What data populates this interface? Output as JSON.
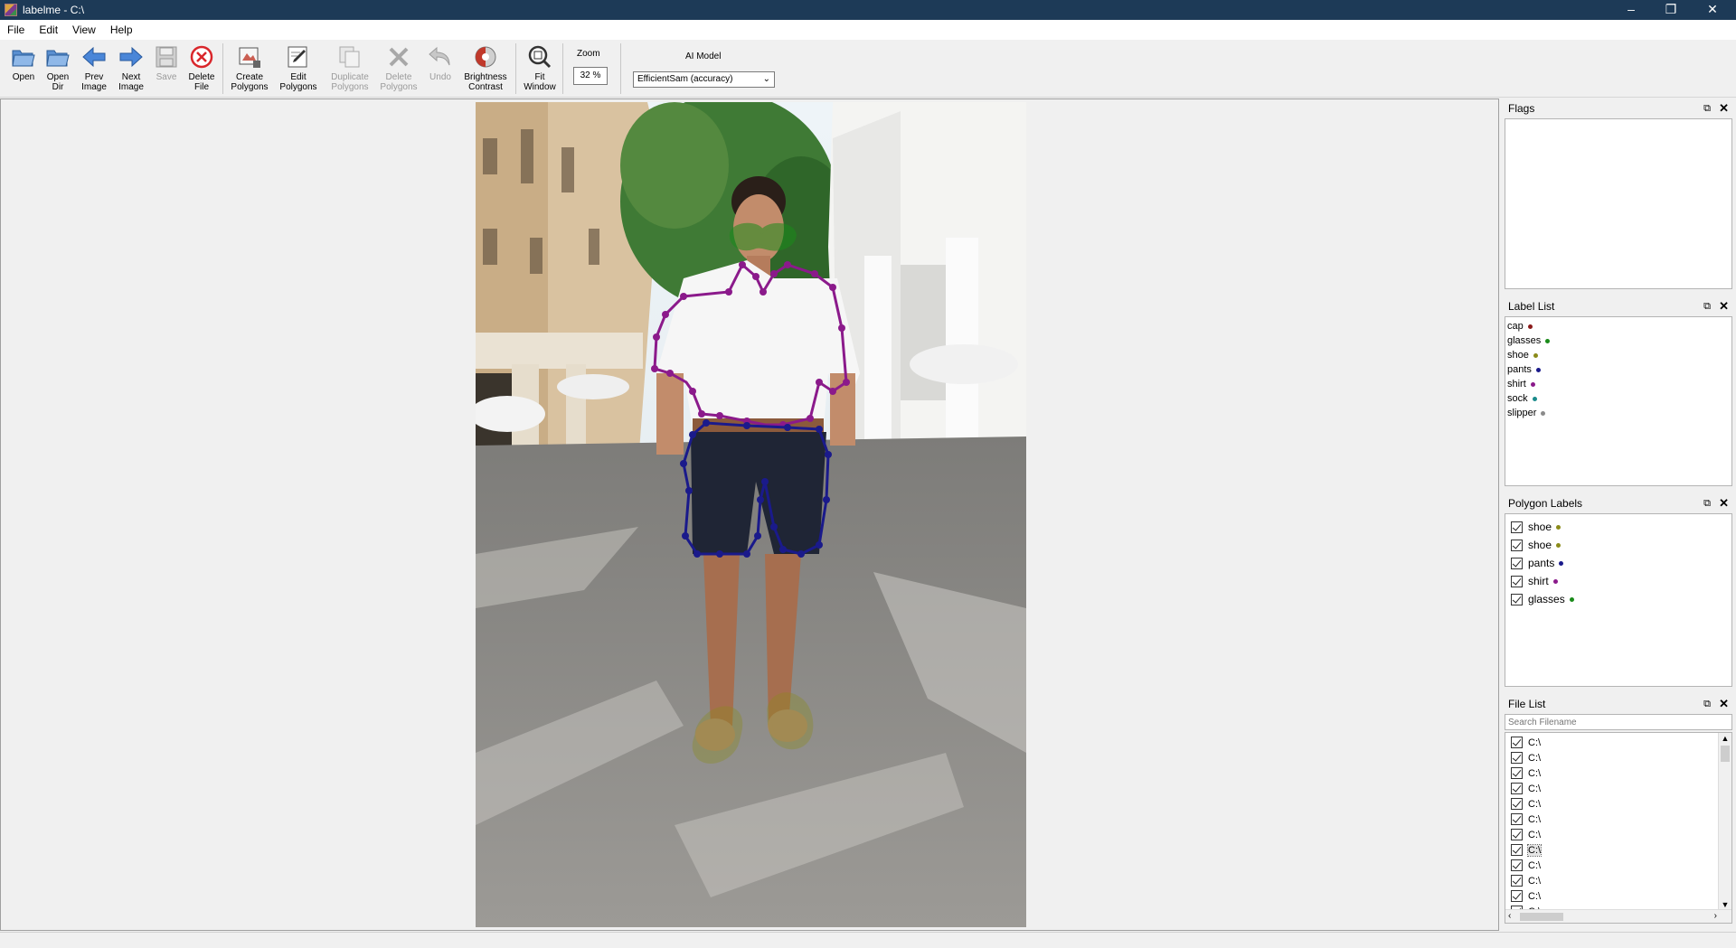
{
  "window": {
    "title": "labelme - C:\\",
    "minimize": "–",
    "restore": "❐",
    "close": "✕"
  },
  "menu": [
    "File",
    "Edit",
    "View",
    "Help"
  ],
  "toolbar": {
    "open": "Open",
    "open_dir": [
      "Open",
      "Dir"
    ],
    "prev_image": [
      "Prev",
      "Image"
    ],
    "next_image": [
      "Next",
      "Image"
    ],
    "save": "Save",
    "delete_file": [
      "Delete",
      "File"
    ],
    "create_polygons": [
      "Create",
      "Polygons"
    ],
    "edit_polygons": [
      "Edit",
      "Polygons"
    ],
    "duplicate_polygons": [
      "Duplicate",
      "Polygons"
    ],
    "delete_polygons": [
      "Delete",
      "Polygons"
    ],
    "undo": "Undo",
    "brightness_contrast": [
      "Brightness",
      "Contrast"
    ],
    "fit_window": [
      "Fit",
      "Window"
    ],
    "zoom_label": "Zoom",
    "zoom_value": "32 %",
    "ai_model_label": "AI Model",
    "ai_model_value": "EfficientSam (accuracy)"
  },
  "docks": {
    "flags": {
      "title": "Flags"
    },
    "label_list": {
      "title": "Label List",
      "items": [
        {
          "label": "cap",
          "color": "#8b1a1a"
        },
        {
          "label": "glasses",
          "color": "#1a8b1a"
        },
        {
          "label": "shoe",
          "color": "#8b8b1a"
        },
        {
          "label": "pants",
          "color": "#1a1a8b"
        },
        {
          "label": "shirt",
          "color": "#8b1a8b"
        },
        {
          "label": "sock",
          "color": "#1a8b8b"
        },
        {
          "label": "slipper",
          "color": "#8b8b8b"
        }
      ]
    },
    "polygon_labels": {
      "title": "Polygon Labels",
      "items": [
        {
          "label": "shoe",
          "color": "#8b8b1a"
        },
        {
          "label": "shoe",
          "color": "#8b8b1a"
        },
        {
          "label": "pants",
          "color": "#1a1a8b"
        },
        {
          "label": "shirt",
          "color": "#8b1a8b"
        },
        {
          "label": "glasses",
          "color": "#1a8b1a"
        }
      ]
    },
    "file_list": {
      "title": "File List",
      "search_placeholder": "Search Filename",
      "files": [
        "C:\\",
        "C:\\",
        "C:\\",
        "C:\\",
        "C:\\",
        "C:\\",
        "C:\\",
        "C:\\",
        "C:\\",
        "C:\\",
        "C:\\",
        "C:\\"
      ],
      "selected_index": 7
    }
  },
  "colors": {
    "shirt": "#8b1a8b",
    "pants": "#1a1a8b",
    "shoe": "#8b8b1a",
    "glasses": "#1a8b1a",
    "titlebar": "#1d3a57"
  }
}
